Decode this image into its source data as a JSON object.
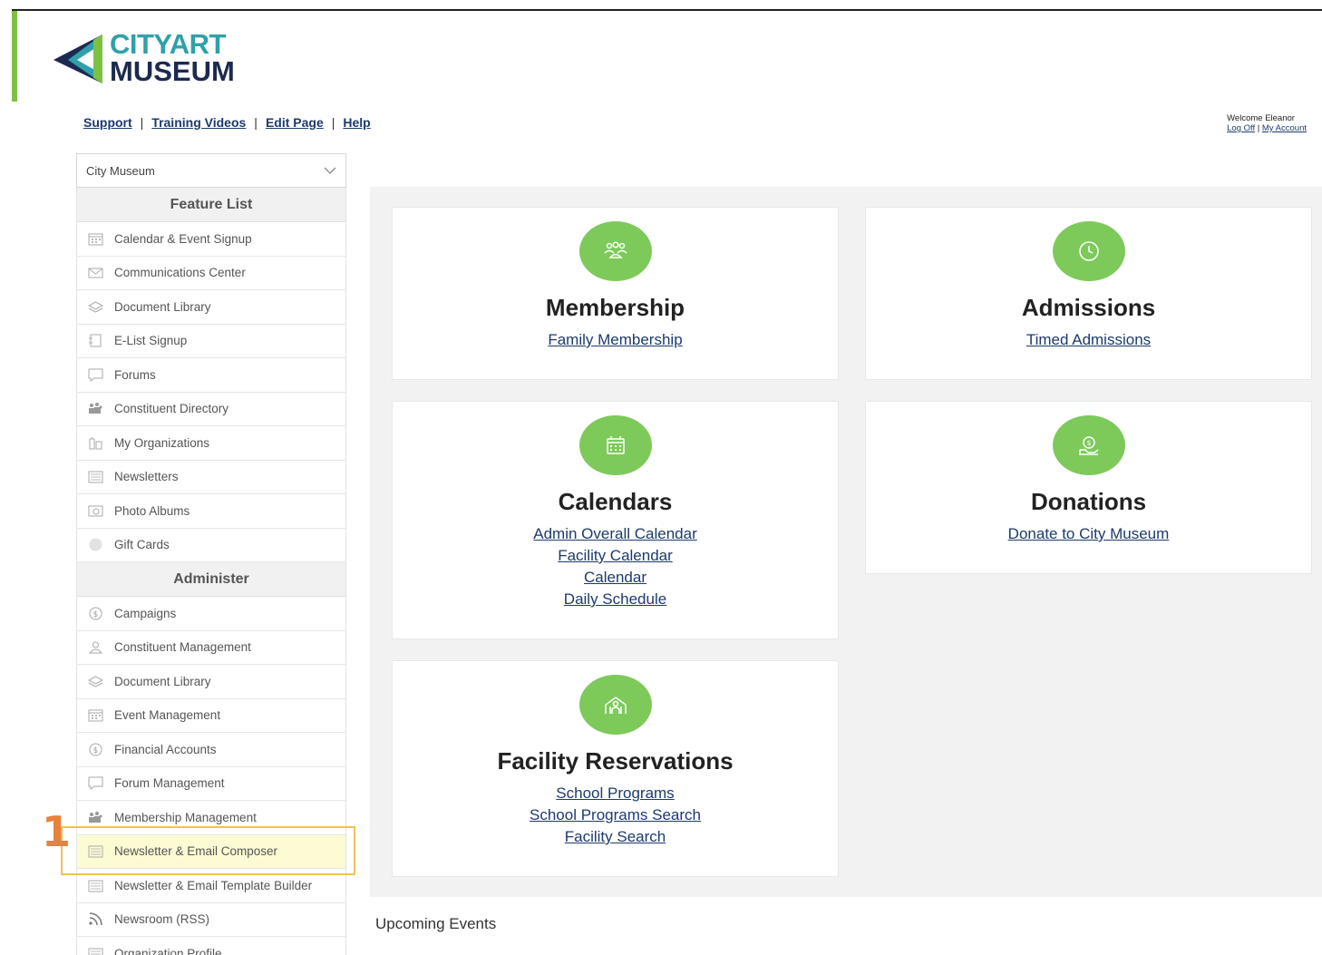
{
  "logo": {
    "city": "CITY",
    "art": "ART",
    "museum": "MUSEUM"
  },
  "top_links": [
    "Support",
    "Training Videos",
    "Edit Page",
    "Help"
  ],
  "welcome": {
    "text": "Welcome Eleanor",
    "log_off": "Log Off",
    "my_account": "My Account",
    "sep": "|"
  },
  "sidebar": {
    "select_value": "City Museum",
    "feature_header": "Feature List",
    "feature_items": [
      {
        "label": "Calendar & Event Signup",
        "icon": "calendar-icon"
      },
      {
        "label": "Communications Center",
        "icon": "envelope-icon"
      },
      {
        "label": "Document Library",
        "icon": "stack-icon"
      },
      {
        "label": "E-List Signup",
        "icon": "form-icon"
      },
      {
        "label": "Forums",
        "icon": "chat-icon"
      },
      {
        "label": "Constituent Directory",
        "icon": "people-icon"
      },
      {
        "label": "My Organizations",
        "icon": "building-icon"
      },
      {
        "label": "Newsletters",
        "icon": "newspaper-icon"
      },
      {
        "label": "Photo Albums",
        "icon": "photo-icon"
      },
      {
        "label": "Gift Cards",
        "icon": "circle-icon"
      }
    ],
    "admin_header": "Administer",
    "admin_items": [
      {
        "label": "Campaigns",
        "icon": "dollar-icon"
      },
      {
        "label": "Constituent Management",
        "icon": "person-icon"
      },
      {
        "label": "Document Library",
        "icon": "stack-icon"
      },
      {
        "label": "Event Management",
        "icon": "calendar-icon"
      },
      {
        "label": "Financial Accounts",
        "icon": "dollar-icon"
      },
      {
        "label": "Forum Management",
        "icon": "chat-icon"
      },
      {
        "label": "Membership Management",
        "icon": "people-icon"
      },
      {
        "label": "Newsletter & Email Composer",
        "icon": "newspaper-icon"
      },
      {
        "label": "Newsletter & Email Template Builder",
        "icon": "newspaper-icon"
      },
      {
        "label": "Newsroom (RSS)",
        "icon": "rss-icon"
      },
      {
        "label": "Organization Profile",
        "icon": "newspaper-icon"
      }
    ]
  },
  "annotation": {
    "step": "1"
  },
  "cards": {
    "membership": {
      "title": "Membership",
      "links": [
        "Family Membership"
      ]
    },
    "admissions": {
      "title": "Admissions",
      "links": [
        "Timed Admissions"
      ]
    },
    "calendars": {
      "title": "Calendars",
      "links": [
        "Admin Overall Calendar",
        "Facility Calendar",
        "Calendar",
        "Daily Schedule"
      ]
    },
    "donations": {
      "title": "Donations",
      "links": [
        "Donate to City Museum"
      ]
    },
    "facility": {
      "title": "Facility Reservations",
      "links": [
        "School Programs",
        "School Programs Search",
        "Facility Search"
      ]
    }
  },
  "upcoming_title": "Upcoming Events",
  "colors": {
    "accent_green": "#7dca5a",
    "logo_teal": "#2ea1aa",
    "link_navy": "#1d3a6e",
    "highlight_border": "#f0c15a",
    "step_orange": "#e8813a"
  }
}
